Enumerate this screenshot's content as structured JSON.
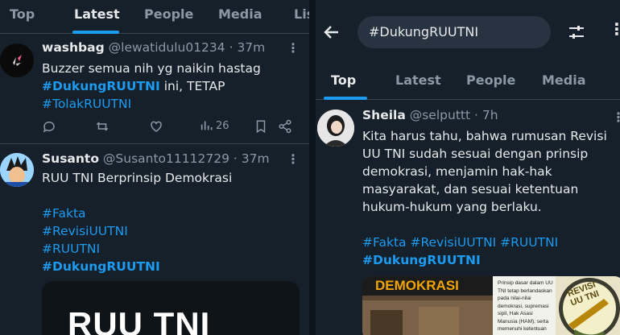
{
  "left": {
    "tabs": [
      "Top",
      "Latest",
      "People",
      "Media",
      "Lis"
    ],
    "active_tab": "Latest",
    "tweets": [
      {
        "name": "washbag",
        "handle": "@lewatidulu01234",
        "time": "· 37m",
        "line1": "Buzzer semua nih yg naikin hastag",
        "tag_bold": "#DukungRUUTNI",
        "line2_rest": " ini, TETAP",
        "tag2": "#TolakRUUTNI",
        "view_count": "26"
      },
      {
        "name": "Susanto",
        "handle": "@Susanto11112729",
        "time": "· 37m",
        "line1": "RUU TNI Berprinsip Demokrasi",
        "tags": [
          "#Fakta",
          "#RevisiUUTNI",
          "#RUUTNI"
        ],
        "tag_bold": "#DukungRUUTNI",
        "media_text": "RUU TNI"
      }
    ]
  },
  "right": {
    "search_value": "#DukungRUUTNI",
    "tabs": [
      "Top",
      "Latest",
      "People",
      "Media"
    ],
    "active_tab": "Top",
    "tweet": {
      "name": "Sheila",
      "handle": "@selputtt",
      "time": "· 7h",
      "lines": [
        "Kita harus tahu, bahwa rumusan Revisi",
        "UU TNI sudah sesuai dengan prinsip",
        "demokrasi, menjamin hak-hak",
        "masyarakat, dan sesuai ketentuan",
        "hukum-hukum yang berlaku."
      ],
      "tags_line": "#Fakta #RevisiUUTNI #RUUTNI",
      "tag_bold": "#DukungRUUTNI",
      "media": {
        "banner": "DEMOKRASI",
        "doc_lines": [
          "Prinsip dasar dalam UU",
          "TNI tetap berlandaskan",
          "pada nilai-nilai",
          "demokrasi, supremasi",
          "sipil, Hak Asasi",
          "Manusia (HAM), serta",
          "memenuhi ketentuan"
        ],
        "badge_line1": "REVISI",
        "badge_line2": "UU TNI"
      }
    }
  },
  "colors": {
    "background": "#15202b",
    "accent": "#1d9bf0",
    "text": "#e7e9ea",
    "muted": "#8b98a5",
    "border": "#38444d"
  }
}
